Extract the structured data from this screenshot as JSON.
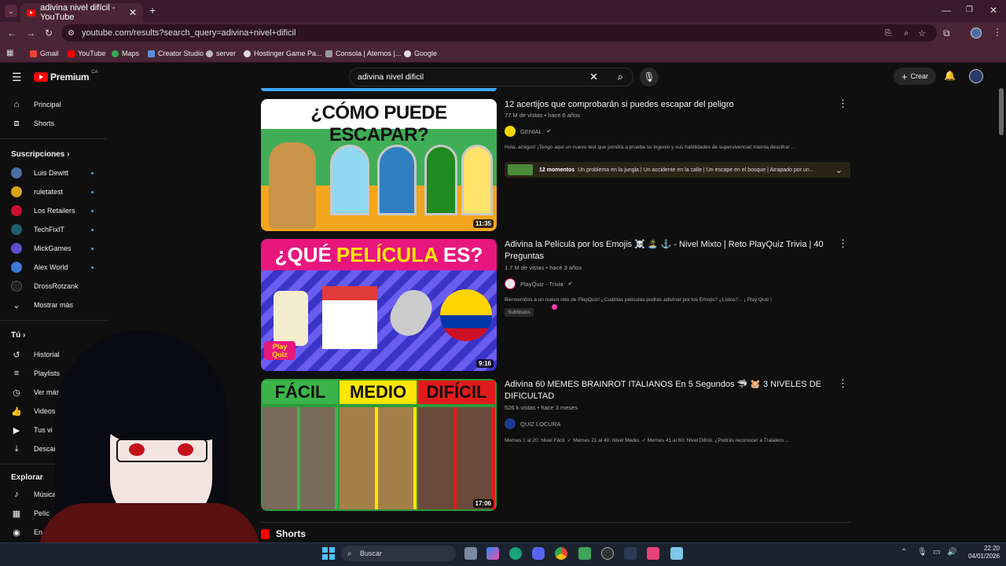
{
  "browser": {
    "tab_title": "adivina nivel difícil - YouTube",
    "url": "youtube.com/results?search_query=adivina+nivel+dificil",
    "bookmarks": [
      "Gmail",
      "YouTube",
      "Maps",
      "Creator Studio",
      "server",
      "Hostinger Game Pa...",
      "Consola | Aternos |...",
      "Google"
    ]
  },
  "youtube": {
    "logo": "Premium",
    "region": "CA",
    "search_value": "adivina nivel dificil",
    "create_label": "Crear"
  },
  "sidebar": {
    "main": [
      {
        "label": "Principal",
        "icon": "home-icon"
      },
      {
        "label": "Shorts",
        "icon": "shorts-icon"
      }
    ],
    "subscriptions_heading": "Suscripciones",
    "subscriptions": [
      {
        "label": "Luis Dewitt",
        "color": "#4a6fa5"
      },
      {
        "label": "ruletatest",
        "color": "#d9a21b"
      },
      {
        "label": "Los Retailers",
        "color": "#c8102e"
      },
      {
        "label": "TechFixIT",
        "color": "#1f5f6f"
      },
      {
        "label": "MickGames",
        "color": "#5a4fcf"
      },
      {
        "label": "Alex World",
        "color": "#3a7bd5"
      },
      {
        "label": "DrossRotzank",
        "color": "#222222"
      }
    ],
    "show_more": "Mostrar más",
    "you_heading": "Tú",
    "you_items": [
      {
        "label": "Historial",
        "icon": "history-icon"
      },
      {
        "label": "Playlists",
        "icon": "playlist-icon"
      },
      {
        "label": "Ver más",
        "icon": "clock-icon"
      },
      {
        "label": "Videos",
        "icon": "like-icon"
      },
      {
        "label": "Tus vi",
        "icon": "your-videos-icon"
      },
      {
        "label": "Descarg",
        "icon": "download-icon"
      }
    ],
    "explore_heading": "Explorar",
    "explore_items": [
      {
        "label": "Música",
        "icon": "music-icon"
      },
      {
        "label": "Pelíc",
        "icon": "movie-icon"
      },
      {
        "label": "En",
        "icon": "live-icon"
      }
    ]
  },
  "results": [
    {
      "thumb_text": "¿CÓMO PUEDE ESCAPAR?",
      "duration": "11:35",
      "title": "12 acertijos que comprobarán si puedes escapar del peligro",
      "meta": "77 M de vistas • hace 6 años",
      "channel": "GENIAL",
      "channel_color": "#f5d800",
      "description": "Hola, amigos! ¡Tengo aquí un nuevo test que pondrá a prueba su ingenio y sus habilidades de supervivencia! Intenta descifrar ...",
      "chapters_count": "12 momentos",
      "chapters_text": "Un problema en la jungla | Un accidente en la calle | Un escape en el bosque | Atrapado por un..."
    },
    {
      "thumb_text_1": "¿QUÉ",
      "thumb_text_2": "PELÍCULA",
      "thumb_text_3": "ES?",
      "thumb_badge": "Play Quiz",
      "duration": "9:16",
      "title": "Adivina la Película por los Emojis ☠️ 🏝️ ⚓ - Nivel Mixto | Reto PlayQuiz Trivia | 40 Preguntas",
      "meta": "1.7 M de vistas • hace 3 años",
      "channel": "PlayQuiz - Trivia",
      "channel_color": "#e8e8e8",
      "description": "Bienvenidos a un nuevo reto de PlayQuiz! ¿Cuántas películas podrás adivinar por los Emojis? ¿Listos?... ¡ Play Quiz !",
      "badge": "Subtítulos"
    },
    {
      "thumb_labels": [
        "FÁCIL",
        "MEDIO",
        "DIFÍCIL"
      ],
      "duration": "17:06",
      "title": "Adivina 60 MEMES BRAINROT ITALIANOS En 5 Segundos 🦈 🐹 3 NIVELES DE DIFICULTAD",
      "meta": "526 k vistas • hace 3 meses",
      "channel": "QUIZ LOCURA",
      "channel_color": "#1a3a8f",
      "description": "Memes 1 al 20: Nivel Fácil. ✓ Memes 21 al 40: Nivel Medio. ✓ Memes 41 al 60: Nivel Difícil. ¿Podrás reconocer a Tralalero ..."
    }
  ],
  "shorts_heading": "Shorts",
  "taskbar": {
    "search_label": "Buscar",
    "time": "22:20",
    "date": "04/01/2026"
  }
}
